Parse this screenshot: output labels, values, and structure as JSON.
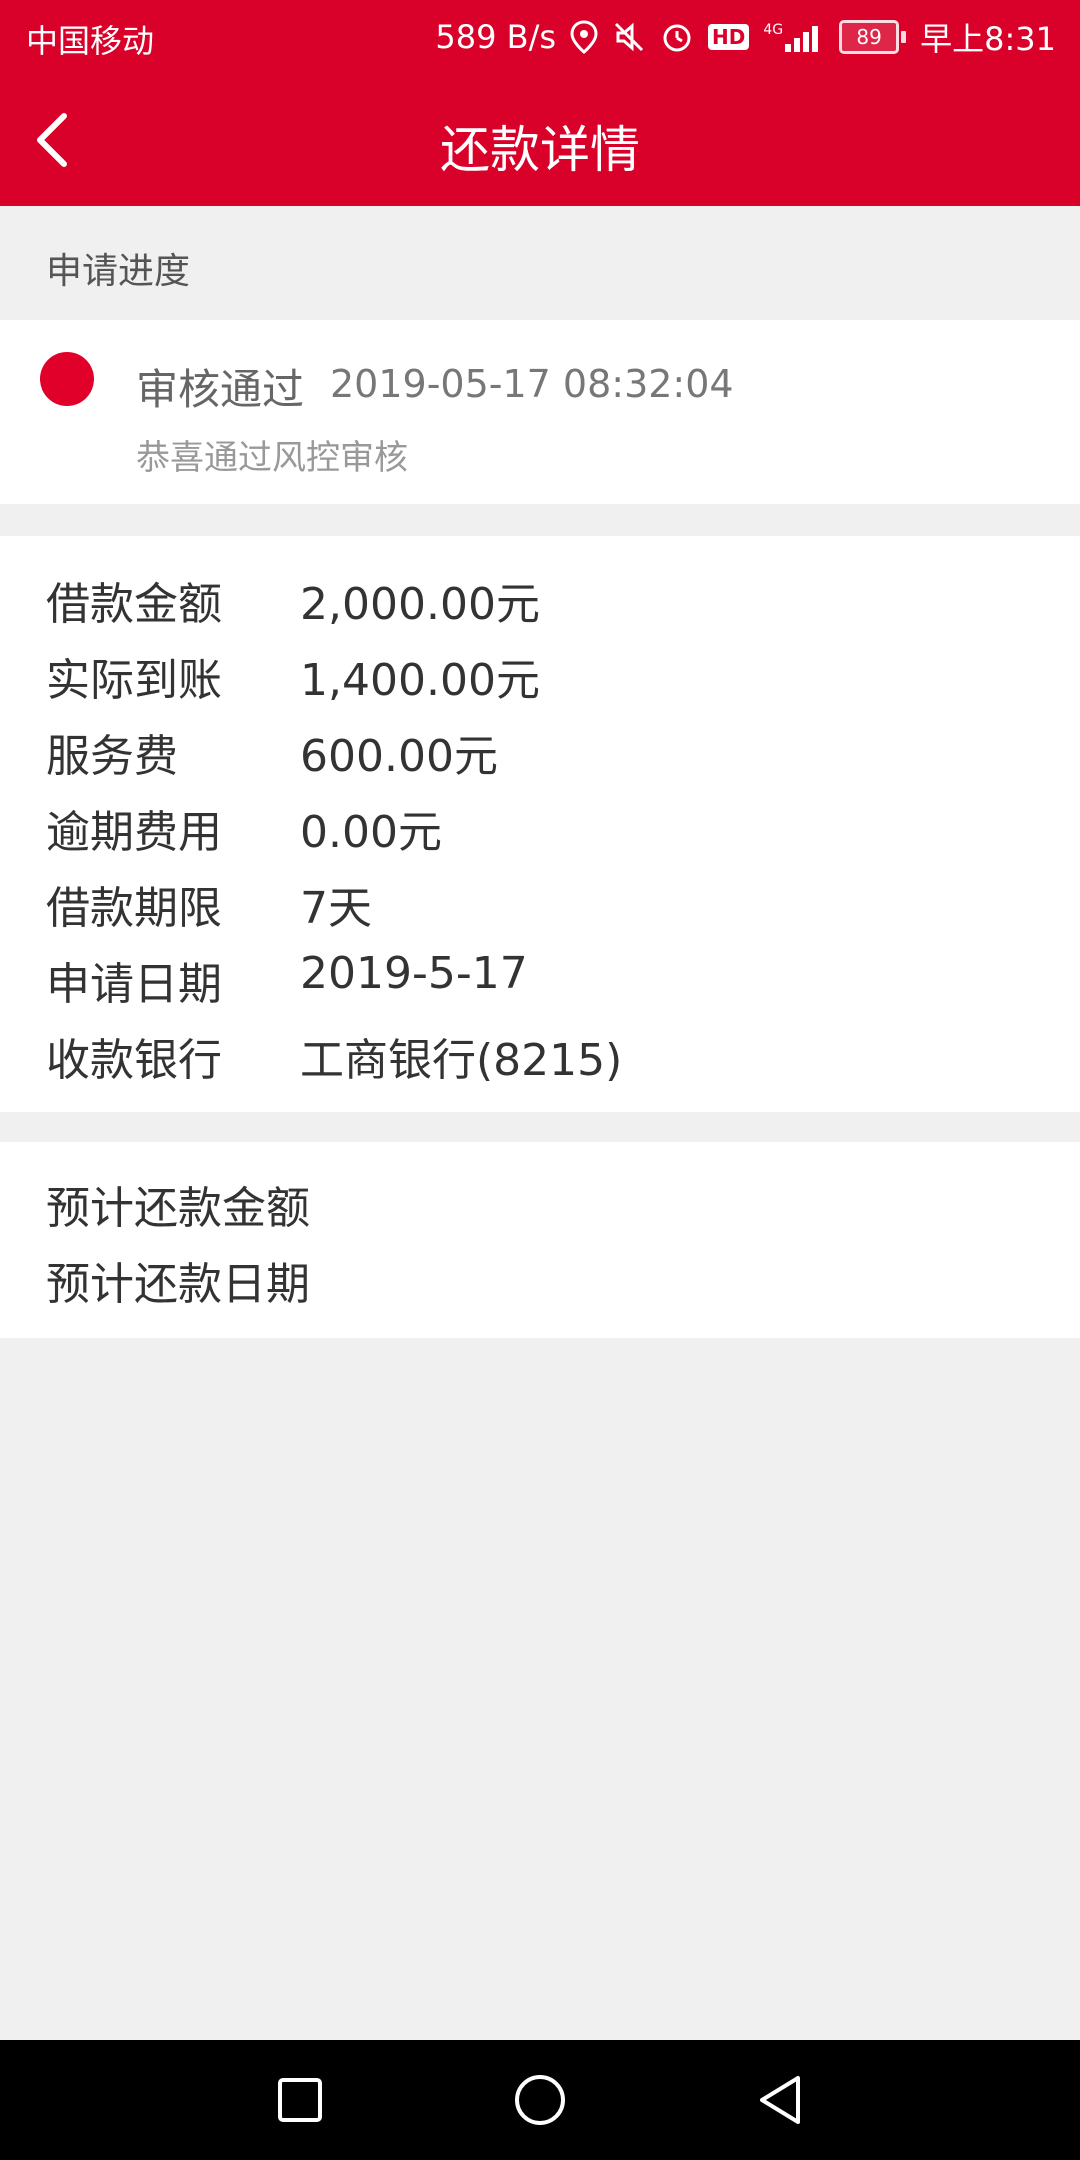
{
  "status_bar": {
    "carrier": "中国移动",
    "network_speed": "589 B/s",
    "network_type": "4G",
    "hd_badge": "HD",
    "battery": "89",
    "time": "早上8:31",
    "icons": [
      "location-icon",
      "mute-icon",
      "alarm-icon",
      "hd-icon",
      "signal-icon",
      "battery-icon"
    ]
  },
  "header": {
    "title": "还款详情",
    "back_icon": "chevron-left-icon"
  },
  "progress": {
    "section_label": "申请进度",
    "status": "审核通过",
    "timestamp": "2019-05-17 08:32:04",
    "message": "恭喜通过风控审核",
    "dot_color": "#e0002a"
  },
  "details": [
    {
      "label": "借款金额",
      "value": "2,000.00元"
    },
    {
      "label": "实际到账",
      "value": "1,400.00元"
    },
    {
      "label": "服务费",
      "value": "600.00元"
    },
    {
      "label": "逾期费用",
      "value": "0.00元"
    },
    {
      "label": "借款期限",
      "value": "7天"
    },
    {
      "label": "申请日期",
      "value": "2019-5-17"
    },
    {
      "label": "收款银行",
      "value": "工商银行(8215)"
    }
  ],
  "repayment": {
    "amount_label": "预计还款金额",
    "date_label": "预计还款日期"
  },
  "nav_bar": {
    "buttons": [
      "recent-apps-icon",
      "home-icon",
      "back-icon"
    ]
  },
  "colors": {
    "brand_red": "#d90029",
    "background": "#f0f0f0"
  }
}
